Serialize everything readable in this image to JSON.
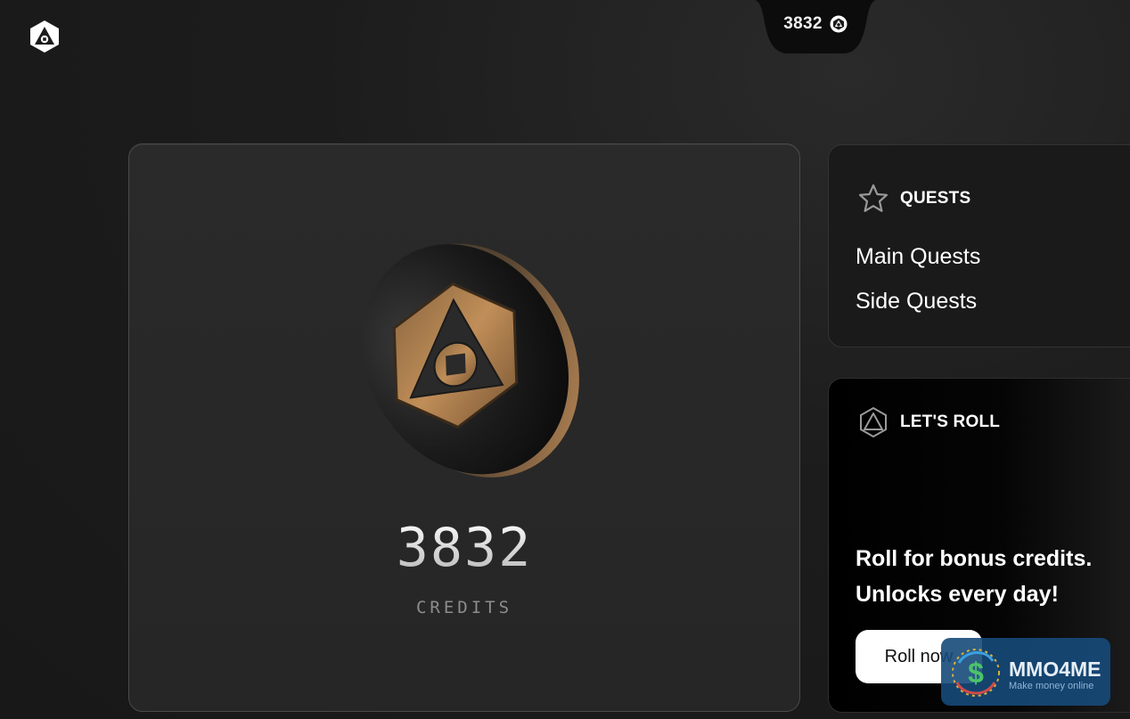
{
  "header": {
    "balance": "3832",
    "balance_icon": "coin-logo-icon",
    "logo_icon": "app-logo-icon"
  },
  "credits_card": {
    "value": "3832",
    "label": "CREDITS",
    "coin_image": "bronze-coin-logo",
    "colors": {
      "accent": "#b58552",
      "card_bg": "#272727"
    }
  },
  "quests_card": {
    "icon": "star-icon",
    "title": "QUESTS",
    "links": [
      "Main Quests",
      "Side Quests"
    ]
  },
  "roll_card": {
    "icon": "hexagon-triangle-icon",
    "title": "LET'S ROLL",
    "lines": [
      "Roll for bonus credits.",
      "Unlocks every day!"
    ],
    "button_label": "Roll now"
  },
  "watermark": {
    "title": "MMO4ME",
    "subtitle": "Make money online",
    "emblem_text": "$"
  }
}
